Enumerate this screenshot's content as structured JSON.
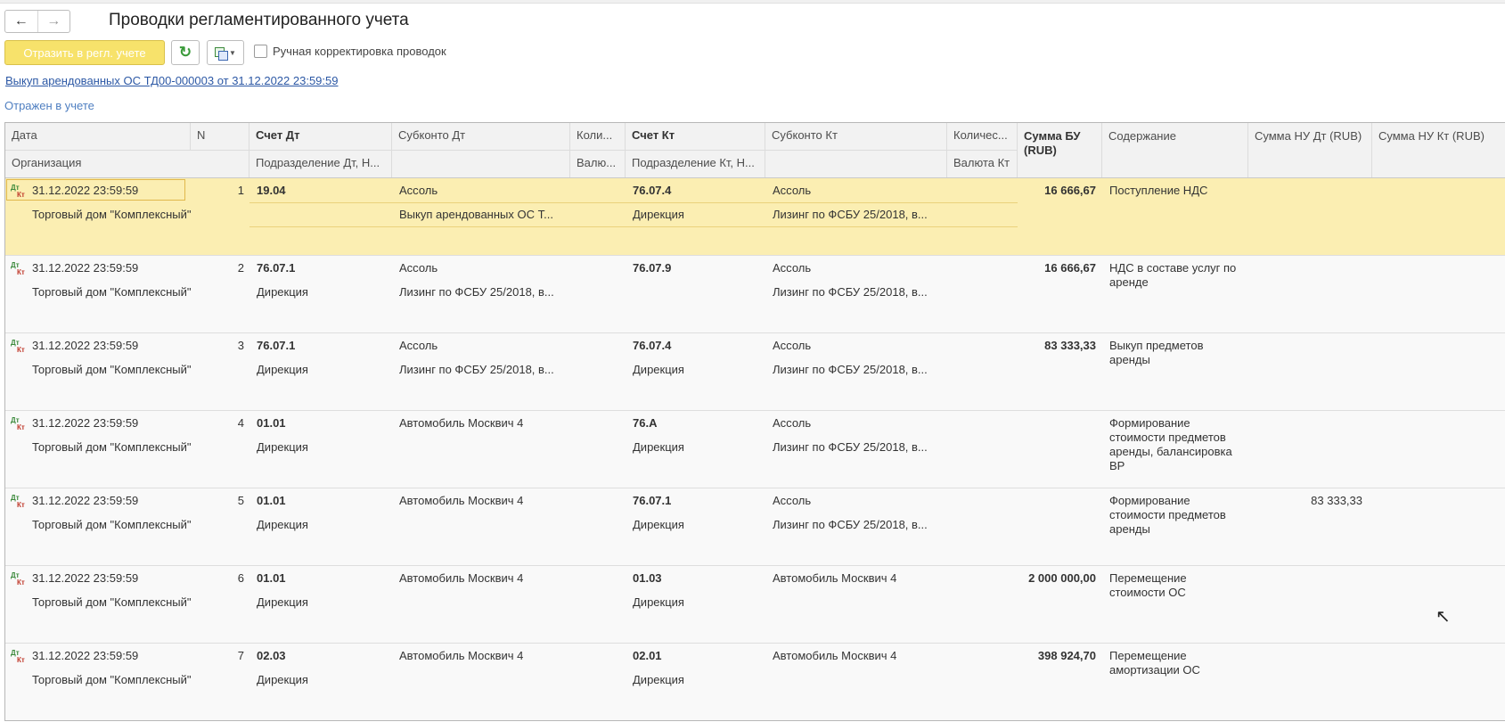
{
  "header": {
    "title": "Проводки регламентированного учета",
    "post_button": "Отразить в регл. учете",
    "manual_adjust_label": "Ручная корректировка проводок",
    "document_link": "Выкуп арендованных ОС ТД00-000003 от 31.12.2022 23:59:59",
    "status": "Отражен в учете"
  },
  "columns": {
    "date": "Дата",
    "n": "N",
    "org": "Организация",
    "acc_dt": "Счет Дт",
    "dept_dt": "Подразделение Дт, Н...",
    "sub_dt": "Субконто Дт",
    "qty_dt": "Коли...",
    "cur_dt": "Валю...",
    "acc_kt": "Счет Кт",
    "dept_kt": "Подразделение Кт, Н...",
    "sub_kt": "Субконто Кт",
    "qty_kt": "Количес...",
    "cur_kt": "Валюта Кт",
    "sum_bu": "Сумма БУ (RUB)",
    "content": "Содержание",
    "sum_nu_dt": "Сумма НУ Дт (RUB)",
    "sum_nu_kt": "Сумма НУ Кт (RUB)"
  },
  "rows": [
    {
      "date": "31.12.2022 23:59:59",
      "n": "1",
      "org": "Торговый дом \"Комплексный\"",
      "acc_dt": "19.04",
      "dept_dt": "",
      "sub_dt1": "Ассоль",
      "sub_dt2": "Выкуп арендованных ОС Т...",
      "acc_kt": "76.07.4",
      "dept_kt": "Дирекция",
      "sub_kt1": "Ассоль",
      "sub_kt2": "Лизинг по ФСБУ 25/2018,  в...",
      "sum_bu": "16 666,67",
      "content": "Поступление НДС",
      "sum_nu_dt": "",
      "sum_nu_kt": ""
    },
    {
      "date": "31.12.2022 23:59:59",
      "n": "2",
      "org": "Торговый дом \"Комплексный\"",
      "acc_dt": "76.07.1",
      "dept_dt": "Дирекция",
      "sub_dt1": "Ассоль",
      "sub_dt2": "Лизинг по ФСБУ 25/2018,  в...",
      "acc_kt": "76.07.9",
      "dept_kt": "",
      "sub_kt1": "Ассоль",
      "sub_kt2": "Лизинг по ФСБУ 25/2018,  в...",
      "sum_bu": "16 666,67",
      "content": "НДС в составе услуг по аренде",
      "sum_nu_dt": "",
      "sum_nu_kt": ""
    },
    {
      "date": "31.12.2022 23:59:59",
      "n": "3",
      "org": "Торговый дом \"Комплексный\"",
      "acc_dt": "76.07.1",
      "dept_dt": "Дирекция",
      "sub_dt1": "Ассоль",
      "sub_dt2": "Лизинг по ФСБУ 25/2018,  в...",
      "acc_kt": "76.07.4",
      "dept_kt": "Дирекция",
      "sub_kt1": "Ассоль",
      "sub_kt2": "Лизинг по ФСБУ 25/2018,  в...",
      "sum_bu": "83 333,33",
      "content": "Выкуп предметов аренды",
      "sum_nu_dt": "",
      "sum_nu_kt": ""
    },
    {
      "date": "31.12.2022 23:59:59",
      "n": "4",
      "org": "Торговый дом \"Комплексный\"",
      "acc_dt": "01.01",
      "dept_dt": "Дирекция",
      "sub_dt1": "Автомобиль Москвич 4",
      "sub_dt2": "",
      "acc_kt": "76.А",
      "dept_kt": "Дирекция",
      "sub_kt1": "Ассоль",
      "sub_kt2": "Лизинг по ФСБУ 25/2018,  в...",
      "sum_bu": "",
      "content": "Формирование стоимости предметов аренды, балансировка ВР",
      "sum_nu_dt": "",
      "sum_nu_kt": ""
    },
    {
      "date": "31.12.2022 23:59:59",
      "n": "5",
      "org": "Торговый дом \"Комплексный\"",
      "acc_dt": "01.01",
      "dept_dt": "Дирекция",
      "sub_dt1": "Автомобиль Москвич 4",
      "sub_dt2": "",
      "acc_kt": "76.07.1",
      "dept_kt": "Дирекция",
      "sub_kt1": "Ассоль",
      "sub_kt2": "Лизинг по ФСБУ 25/2018,  в...",
      "sum_bu": "",
      "content": "Формирование стоимости предметов аренды",
      "sum_nu_dt": "83 333,33",
      "sum_nu_kt": ""
    },
    {
      "date": "31.12.2022 23:59:59",
      "n": "6",
      "org": "Торговый дом \"Комплексный\"",
      "acc_dt": "01.01",
      "dept_dt": "Дирекция",
      "sub_dt1": "Автомобиль Москвич 4",
      "sub_dt2": "",
      "acc_kt": "01.03",
      "dept_kt": "Дирекция",
      "sub_kt1": "Автомобиль Москвич 4",
      "sub_kt2": "",
      "sum_bu": "2 000 000,00",
      "content": "Перемещение стоимости ОС",
      "sum_nu_dt": "",
      "sum_nu_kt": ""
    },
    {
      "date": "31.12.2022 23:59:59",
      "n": "7",
      "org": "Торговый дом \"Комплексный\"",
      "acc_dt": "02.03",
      "dept_dt": "Дирекция",
      "sub_dt1": "Автомобиль Москвич 4",
      "sub_dt2": "",
      "acc_kt": "02.01",
      "dept_kt": "Дирекция",
      "sub_kt1": "Автомобиль Москвич 4",
      "sub_kt2": "",
      "sum_bu": "398 924,70",
      "content": "Перемещение амортизации ОС",
      "sum_nu_dt": "",
      "sum_nu_kt": ""
    }
  ],
  "icons": {
    "back": "arrow-left-icon",
    "forward": "arrow-right-icon",
    "refresh": "refresh-icon",
    "copy": "copy-icon",
    "entry_type": "dt-kt-icon",
    "mouse": "mouse-pointer-icon"
  },
  "colors": {
    "post_button": "#f7e26b",
    "selected_row": "#fbeeb2",
    "link": "#2c58a5"
  },
  "mark": {
    "dt": "Дт",
    "kt": "Кт"
  }
}
